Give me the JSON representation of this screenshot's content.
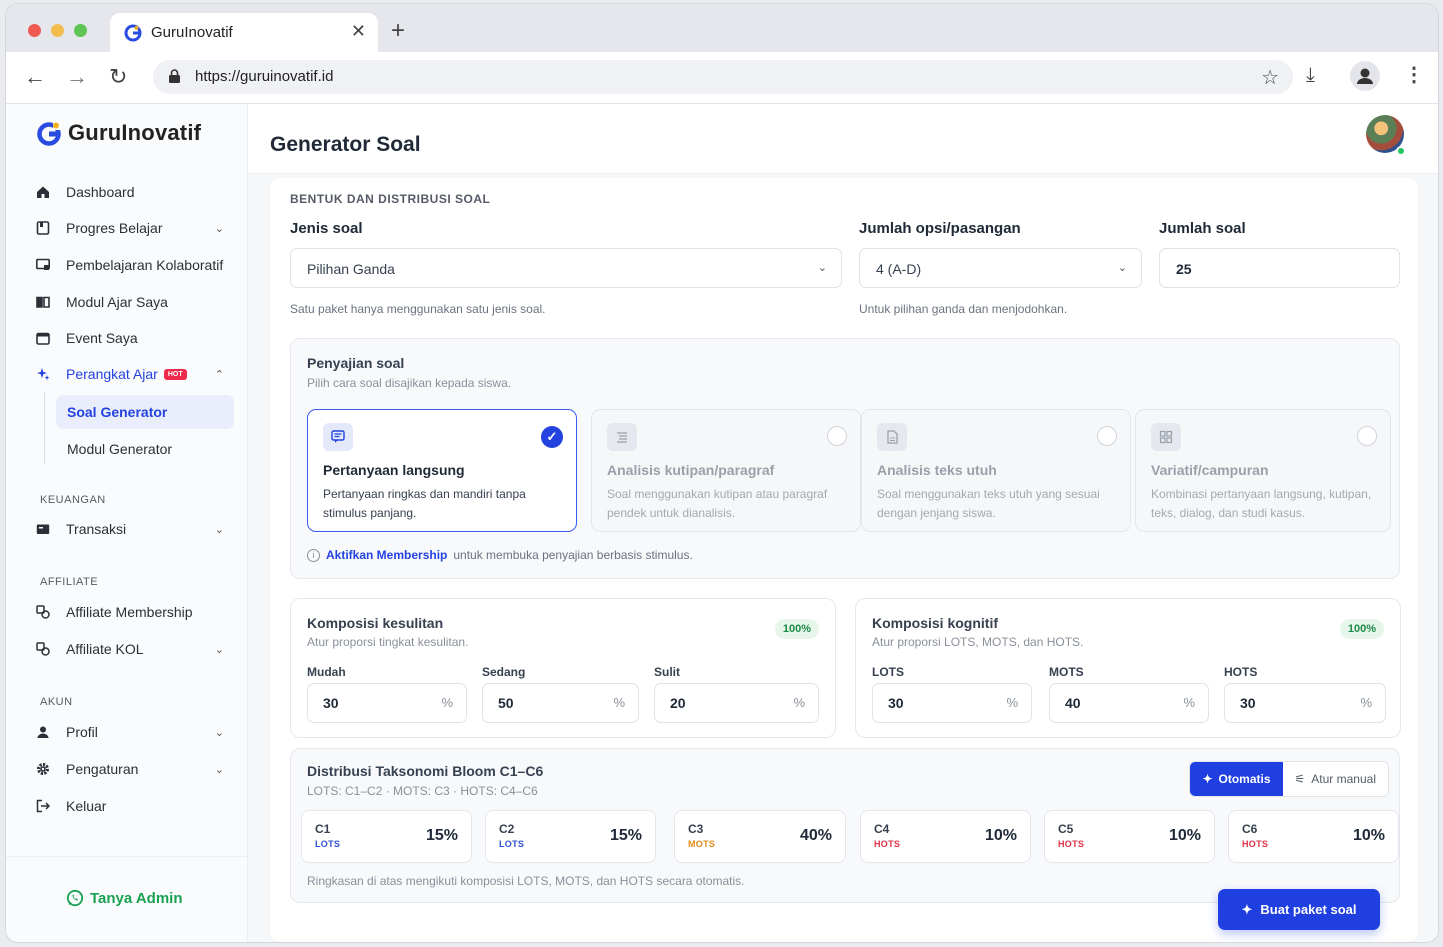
{
  "browser": {
    "tab_title": "GuruInovatif",
    "url": "https://guruinovatif.id"
  },
  "sidebar": {
    "brand": "GuruInovatif",
    "items": [
      {
        "label": "Dashboard"
      },
      {
        "label": "Progres Belajar"
      },
      {
        "label": "Pembelajaran Kolaboratif"
      },
      {
        "label": "Modul Ajar Saya"
      },
      {
        "label": "Event Saya"
      },
      {
        "label": "Perangkat Ajar",
        "badge": "HOT"
      }
    ],
    "sub_items": [
      {
        "label": "Soal Generator"
      },
      {
        "label": "Modul Generator"
      }
    ],
    "sections": {
      "keuangan": "KEUANGAN",
      "affiliate": "AFFILIATE",
      "akun": "AKUN"
    },
    "keuangan_items": [
      {
        "label": "Transaksi"
      }
    ],
    "affiliate_items": [
      {
        "label": "Affiliate Membership"
      },
      {
        "label": "Affiliate KOL"
      }
    ],
    "akun_items": [
      {
        "label": "Profil"
      },
      {
        "label": "Pengaturan"
      },
      {
        "label": "Keluar"
      }
    ],
    "help_link": "Tanya Admin"
  },
  "main": {
    "title": "Generator Soal",
    "section_title": "BENTUK DAN DISTRIBUSI SOAL",
    "jenis_soal": {
      "label": "Jenis soal",
      "value": "Pilihan Ganda",
      "help": "Satu paket hanya menggunakan satu jenis soal."
    },
    "jumlah_opsi": {
      "label": "Jumlah opsi/pasangan",
      "value": "4 (A-D)",
      "help": "Untuk pilihan ganda dan menjodohkan."
    },
    "jumlah_soal": {
      "label": "Jumlah soal",
      "value": "25"
    },
    "penyajian": {
      "title": "Penyajian soal",
      "subtitle": "Pilih cara soal disajikan kepada siswa.",
      "options": [
        {
          "title": "Pertanyaan langsung",
          "desc": "Pertanyaan ringkas dan mandiri tanpa stimulus panjang.",
          "selected": true
        },
        {
          "title": "Analisis kutipan/paragraf",
          "desc": "Soal menggunakan kutipan atau paragraf pendek untuk dianalisis.",
          "selected": false
        },
        {
          "title": "Analisis teks utuh",
          "desc": "Soal menggunakan teks utuh yang sesuai dengan jenjang siswa.",
          "selected": false
        },
        {
          "title": "Variatif/campuran",
          "desc": "Kombinasi pertanyaan langsung, kutipan, teks, dialog, dan studi kasus.",
          "selected": false
        }
      ],
      "membership_link": "Aktifkan Membership",
      "membership_text": "untuk membuka penyajian berbasis stimulus."
    },
    "kesulitan": {
      "title": "Komposisi kesulitan",
      "subtitle": "Atur proporsi tingkat kesulitan.",
      "total": "100%",
      "fields": [
        {
          "label": "Mudah",
          "value": "30",
          "unit": "%"
        },
        {
          "label": "Sedang",
          "value": "50",
          "unit": "%"
        },
        {
          "label": "Sulit",
          "value": "20",
          "unit": "%"
        }
      ]
    },
    "kognitif": {
      "title": "Komposisi kognitif",
      "subtitle": "Atur proporsi LOTS, MOTS, dan HOTS.",
      "total": "100%",
      "fields": [
        {
          "label": "LOTS",
          "value": "30",
          "unit": "%"
        },
        {
          "label": "MOTS",
          "value": "40",
          "unit": "%"
        },
        {
          "label": "HOTS",
          "value": "30",
          "unit": "%"
        }
      ]
    },
    "bloom": {
      "title": "Distribusi Taksonomi Bloom C1–C6",
      "subtitle": "LOTS: C1–C2 · MOTS: C3 · HOTS: C4–C6",
      "mode_auto": "Otomatis",
      "mode_manual": "Atur manual",
      "levels": [
        {
          "name": "C1",
          "category": "LOTS",
          "pct": "15%",
          "color": "#2f4fd8"
        },
        {
          "name": "C2",
          "category": "LOTS",
          "pct": "15%",
          "color": "#2f4fd8"
        },
        {
          "name": "C3",
          "category": "MOTS",
          "pct": "40%",
          "color": "#e08a16"
        },
        {
          "name": "C4",
          "category": "HOTS",
          "pct": "10%",
          "color": "#e0304a"
        },
        {
          "name": "C5",
          "category": "HOTS",
          "pct": "10%",
          "color": "#e0304a"
        },
        {
          "name": "C6",
          "category": "HOTS",
          "pct": "10%",
          "color": "#e0304a"
        }
      ],
      "note": "Ringkasan di atas mengikuti komposisi LOTS, MOTS, dan HOTS secara otomatis."
    },
    "cta": "Buat paket soal"
  },
  "colors": {
    "accent": "#2442e0",
    "success": "#1c8a45",
    "hot": "#ef2b4b"
  }
}
